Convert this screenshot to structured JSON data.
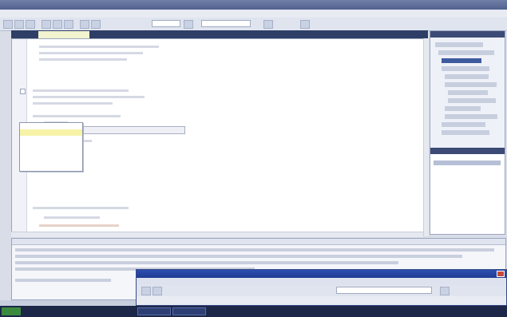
{
  "window": {
    "title": ""
  },
  "menubar": {
    "items": []
  },
  "editor": {
    "tabs": [
      {
        "label": ""
      },
      {
        "label": ""
      }
    ]
  },
  "intellisense": {
    "items": [
      {
        "label": ""
      },
      {
        "label": ""
      },
      {
        "label": ""
      },
      {
        "label": ""
      },
      {
        "label": ""
      },
      {
        "label": ""
      },
      {
        "label": ""
      }
    ]
  },
  "tooltip": {
    "text": ""
  },
  "right_panel": {
    "title": ""
  },
  "output": {
    "title": ""
  },
  "popup": {
    "title": "",
    "menu": ""
  },
  "taskbar": {
    "start_label": "",
    "tasks": [
      {
        "label": ""
      },
      {
        "label": ""
      }
    ]
  },
  "status": {
    "text": ""
  },
  "colors": {
    "titlebar": "#51618f",
    "tabstrip": "#2f3e66",
    "popup_title": "#1f3c93",
    "taskbar": "#1d2748",
    "selection": "#f7f3a8"
  }
}
